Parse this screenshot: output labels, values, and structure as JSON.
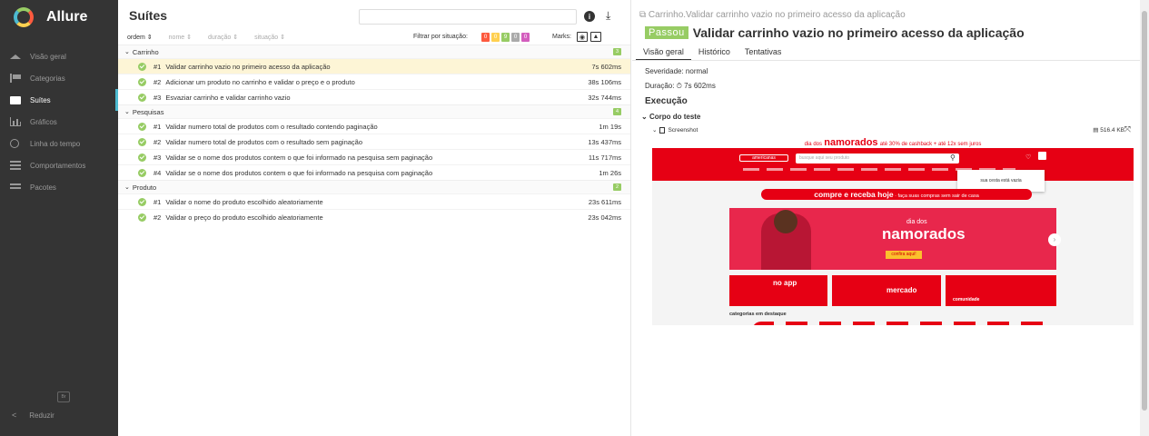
{
  "sidebar": {
    "brand": "Allure",
    "items": [
      {
        "label": "Visão geral",
        "icon": "home-icon"
      },
      {
        "label": "Categorias",
        "icon": "flag-icon"
      },
      {
        "label": "Suítes",
        "icon": "briefcase-icon",
        "active": true
      },
      {
        "label": "Gráficos",
        "icon": "bar-chart-icon"
      },
      {
        "label": "Linha do tempo",
        "icon": "clock-icon"
      },
      {
        "label": "Comportamentos",
        "icon": "list-icon"
      },
      {
        "label": "Pacotes",
        "icon": "lines-icon"
      }
    ],
    "lang": "Br",
    "collapse": "Reduzir"
  },
  "list": {
    "title": "Suítes",
    "sort": [
      "ordem",
      "nome",
      "duração",
      "situação"
    ],
    "filter_label": "Filtrar por situação:",
    "status_counts": [
      "0",
      "0",
      "9",
      "0",
      "0"
    ],
    "marks_label": "Marks:",
    "groups": [
      {
        "name": "Carrinho",
        "count": "3",
        "tests": [
          {
            "num": "#1",
            "name": "Validar carrinho vazio no primeiro acesso da aplicação",
            "duration": "7s 602ms"
          },
          {
            "num": "#2",
            "name": "Adicionar um produto no carrinho e validar o preço e o produto",
            "duration": "38s 106ms"
          },
          {
            "num": "#3",
            "name": "Esvaziar carrinho e validar carrinho vazio",
            "duration": "32s 744ms"
          }
        ]
      },
      {
        "name": "Pesquisas",
        "count": "4",
        "tests": [
          {
            "num": "#1",
            "name": "Validar numero total de produtos com o resultado contendo paginação",
            "duration": "1m 19s"
          },
          {
            "num": "#2",
            "name": "Validar numero total de produtos com o resultado sem paginação",
            "duration": "13s 437ms"
          },
          {
            "num": "#3",
            "name": "Validar se o nome dos produtos contem o que foi informado na pesquisa sem paginação",
            "duration": "11s 717ms"
          },
          {
            "num": "#4",
            "name": "Validar se o nome dos produtos contem o que foi informado na pesquisa com paginação",
            "duration": "1m 26s"
          }
        ]
      },
      {
        "name": "Produto",
        "count": "2",
        "tests": [
          {
            "num": "#1",
            "name": "Validar o nome do produto escolhido aleatoriamente",
            "duration": "23s 611ms"
          },
          {
            "num": "#2",
            "name": "Validar o preço do produto escolhido aleatoriamente",
            "duration": "23s 042ms"
          }
        ]
      }
    ]
  },
  "detail": {
    "path": "Carrinho.Validar carrinho vazio no primeiro acesso da aplicação",
    "status": "Passou",
    "title": "Validar carrinho vazio no primeiro acesso da aplicação",
    "tabs": [
      "Visão geral",
      "Histórico",
      "Tentativas"
    ],
    "severity": "Severidade: normal",
    "duration": "Duração: ⏱ 7s 602ms",
    "execution": "Execução",
    "body_title": "Corpo do teste",
    "attachment_name": "Screenshot",
    "attachment_size": "516.4 KB"
  },
  "screenshot": {
    "promo_prefix": "dia dos",
    "promo_bold": "namorados",
    "promo_suffix": "até 30% de cashback + até 12x sem juros",
    "logo": "americanas",
    "search_placeholder": "busque aqui seu produto",
    "cart_popup": "sua cesta está vazia",
    "cta_bold": "compre e receba hoje",
    "cta_rest": " · faça suas compras sem sair de casa",
    "banner_small": "dia dos",
    "banner_big": "namorados",
    "banner_button": "confira aqui!",
    "card1": "no app",
    "card2": "mercado",
    "card3": "comunidade",
    "categories_title": "categorias em destaque"
  },
  "colors": {
    "sidebar_bg": "#343434",
    "passed": "#97cc64",
    "failed": "#fd5a3e",
    "broken": "#ffd050",
    "skipped": "#aaaaaa",
    "unknown": "#d35ebe",
    "selected_row": "#fdf5d6",
    "site_red": "#e60014"
  }
}
